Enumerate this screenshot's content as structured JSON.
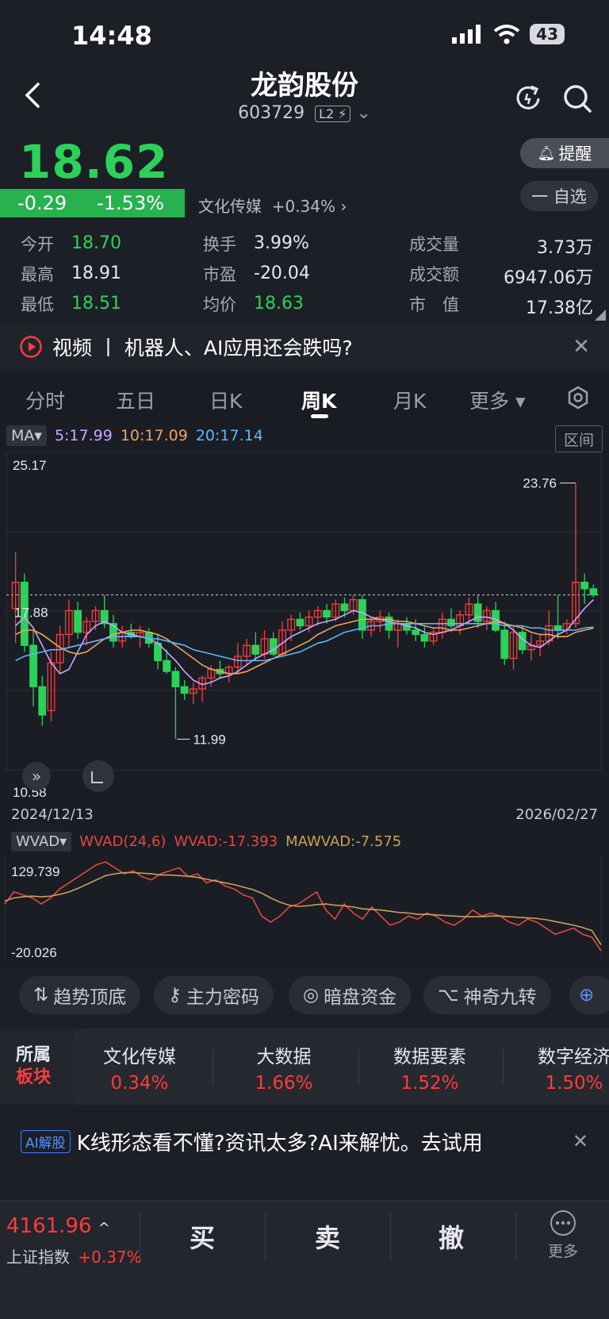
{
  "status_bar": {
    "time": "14:48",
    "battery": "43"
  },
  "header": {
    "title": "龙韵股份",
    "code": "603729",
    "level": "L2"
  },
  "quote": {
    "price": "18.62",
    "change": "-0.29",
    "change_pct": "-1.53%",
    "sector_name": "文化传媒",
    "sector_change": "+0.34%",
    "alert_label": "提醒",
    "watch_label": "一 自选"
  },
  "stats": {
    "open_label": "今开",
    "open": "18.70",
    "high_label": "最高",
    "high": "18.91",
    "low_label": "最低",
    "low": "18.51",
    "turnover_label": "换手",
    "turnover": "3.99%",
    "pe_label": "市盈",
    "pe": "-20.04",
    "avg_label": "均价",
    "avg": "18.63",
    "volume_label": "成交量",
    "volume": "3.73万",
    "amount_label": "成交额",
    "amount": "6947.06万",
    "cap_label": "市　值",
    "cap": "17.38亿"
  },
  "news": {
    "text": "视频  丨  机器人、AI应用还会跌吗?"
  },
  "tabs": [
    "分时",
    "五日",
    "日K",
    "周K",
    "月K",
    "更多"
  ],
  "ma": {
    "label": "MA",
    "ma5": "5:17.99",
    "ma10": "10:17.09",
    "ma20": "20:17.14",
    "range_label": "区间"
  },
  "colors": {
    "up": "#ff3b3b",
    "down": "#2bd25a",
    "ma5": "#c9a6ff",
    "ma10": "#f0a35c",
    "ma20": "#5bb8ff",
    "wvad": "#e6473f",
    "mawvad": "#c9a05a"
  },
  "chart_data": [
    {
      "type": "candlestick",
      "title": "周K",
      "y_top_label": "25.17",
      "y_bottom_label": "10.58",
      "ref_label": "17.88",
      "max_label": "23.76",
      "min_label": "11.99",
      "start_date": "2024/12/13",
      "end_date": "2026/02/27",
      "ylim": [
        10.58,
        25.17
      ],
      "candles": [
        [
          18.0,
          20.6,
          16.4,
          19.2
        ],
        [
          19.2,
          19.6,
          16.0,
          16.3
        ],
        [
          16.3,
          17.0,
          13.5,
          14.4
        ],
        [
          14.4,
          14.9,
          12.6,
          13.1
        ],
        [
          13.3,
          16.0,
          12.8,
          15.5
        ],
        [
          15.5,
          17.2,
          15.0,
          16.8
        ],
        [
          16.8,
          18.4,
          16.2,
          17.9
        ],
        [
          17.9,
          18.3,
          16.6,
          16.9
        ],
        [
          16.9,
          17.6,
          16.3,
          17.4
        ],
        [
          17.4,
          18.1,
          17.0,
          17.9
        ],
        [
          17.9,
          18.6,
          17.1,
          17.3
        ],
        [
          17.3,
          17.7,
          16.2,
          16.5
        ],
        [
          16.5,
          17.2,
          16.2,
          16.9
        ],
        [
          16.9,
          17.3,
          16.6,
          16.7
        ],
        [
          16.7,
          17.2,
          16.2,
          16.9
        ],
        [
          16.9,
          17.1,
          16.2,
          16.4
        ],
        [
          16.4,
          16.8,
          15.2,
          15.6
        ],
        [
          15.6,
          16.1,
          15.0,
          15.1
        ],
        [
          15.1,
          15.3,
          11.99,
          14.4
        ],
        [
          14.4,
          14.7,
          13.8,
          14.1
        ],
        [
          14.1,
          14.6,
          13.6,
          14.3
        ],
        [
          14.3,
          14.9,
          13.7,
          14.8
        ],
        [
          14.8,
          15.4,
          14.4,
          15.2
        ],
        [
          15.2,
          15.6,
          14.8,
          15.0
        ],
        [
          15.0,
          15.4,
          14.6,
          15.3
        ],
        [
          15.3,
          16.4,
          15.0,
          15.8
        ],
        [
          15.8,
          16.6,
          15.4,
          16.3
        ],
        [
          16.3,
          16.9,
          15.6,
          15.9
        ],
        [
          15.9,
          17.0,
          15.7,
          16.6
        ],
        [
          16.6,
          16.9,
          15.8,
          15.9
        ],
        [
          15.9,
          17.4,
          15.8,
          17.0
        ],
        [
          17.0,
          17.7,
          16.5,
          17.5
        ],
        [
          17.5,
          17.8,
          17.0,
          17.2
        ],
        [
          17.2,
          17.9,
          16.9,
          17.6
        ],
        [
          17.6,
          18.1,
          17.2,
          17.9
        ],
        [
          17.9,
          18.2,
          17.3,
          17.6
        ],
        [
          17.6,
          18.4,
          17.4,
          18.2
        ],
        [
          18.2,
          18.5,
          17.6,
          17.9
        ],
        [
          17.9,
          18.6,
          17.7,
          18.4
        ],
        [
          18.4,
          18.6,
          16.6,
          17.0
        ],
        [
          17.0,
          17.6,
          16.7,
          17.4
        ],
        [
          17.4,
          17.9,
          16.9,
          17.6
        ],
        [
          17.6,
          17.8,
          16.6,
          17.0
        ],
        [
          17.0,
          17.5,
          16.2,
          17.3
        ],
        [
          17.3,
          17.6,
          16.8,
          17.0
        ],
        [
          17.0,
          17.5,
          16.5,
          16.8
        ],
        [
          16.8,
          17.2,
          16.2,
          16.5
        ],
        [
          16.5,
          17.1,
          16.3,
          16.9
        ],
        [
          16.9,
          17.8,
          16.6,
          17.5
        ],
        [
          17.5,
          18.0,
          16.9,
          17.2
        ],
        [
          17.2,
          17.9,
          16.8,
          17.7
        ],
        [
          17.7,
          18.5,
          17.3,
          18.2
        ],
        [
          18.2,
          18.6,
          17.1,
          17.4
        ],
        [
          17.4,
          18.1,
          17.0,
          17.9
        ],
        [
          17.9,
          18.3,
          16.9,
          17.0
        ],
        [
          17.0,
          17.4,
          15.4,
          15.7
        ],
        [
          15.7,
          17.2,
          15.2,
          16.9
        ],
        [
          16.9,
          17.2,
          15.9,
          16.1
        ],
        [
          16.1,
          16.8,
          15.6,
          16.3
        ],
        [
          16.3,
          16.8,
          15.8,
          16.5
        ],
        [
          16.5,
          17.9,
          16.3,
          17.2
        ],
        [
          17.2,
          18.6,
          16.6,
          17.0
        ],
        [
          17.0,
          17.5,
          16.8,
          17.3
        ],
        [
          17.3,
          23.76,
          17.1,
          19.2
        ],
        [
          19.2,
          19.6,
          18.2,
          18.9
        ],
        [
          18.9,
          19.1,
          18.5,
          18.62
        ]
      ],
      "ma5": [
        17.2,
        17.6,
        17.1,
        16.3,
        15.5,
        15.0,
        15.2,
        16.0,
        16.8,
        17.2,
        17.4,
        17.2,
        16.9,
        16.8,
        16.7,
        16.6,
        16.4,
        16.0,
        15.6,
        15.1,
        14.7,
        14.5,
        14.6,
        14.8,
        14.9,
        15.1,
        15.4,
        15.7,
        15.9,
        16.1,
        16.4,
        16.7,
        16.9,
        17.1,
        17.3,
        17.4,
        17.5,
        17.7,
        17.9,
        17.8,
        17.6,
        17.5,
        17.4,
        17.3,
        17.2,
        17.1,
        16.9,
        16.8,
        16.9,
        17.0,
        17.2,
        17.4,
        17.6,
        17.6,
        17.5,
        17.3,
        17.0,
        16.6,
        16.3,
        16.2,
        16.5,
        16.8,
        17.0,
        17.5,
        18.0,
        18.4
      ],
      "ma10": [
        16.8,
        17.0,
        17.0,
        16.8,
        16.5,
        16.2,
        16.0,
        15.9,
        16.0,
        16.3,
        16.6,
        16.8,
        16.9,
        17.0,
        17.0,
        16.9,
        16.8,
        16.6,
        16.3,
        16.0,
        15.7,
        15.4,
        15.2,
        15.1,
        15.0,
        15.0,
        15.1,
        15.3,
        15.5,
        15.7,
        15.9,
        16.1,
        16.3,
        16.5,
        16.8,
        17.0,
        17.2,
        17.3,
        17.4,
        17.5,
        17.5,
        17.5,
        17.5,
        17.4,
        17.4,
        17.3,
        17.2,
        17.1,
        17.1,
        17.0,
        17.0,
        17.1,
        17.2,
        17.3,
        17.4,
        17.3,
        17.2,
        17.1,
        16.9,
        16.8,
        16.8,
        16.7,
        16.7,
        16.9,
        17.0,
        17.09
      ],
      "ma20": [
        15.6,
        15.8,
        15.9,
        16.0,
        16.1,
        16.1,
        16.2,
        16.3,
        16.4,
        16.5,
        16.6,
        16.7,
        16.7,
        16.7,
        16.7,
        16.6,
        16.6,
        16.5,
        16.4,
        16.3,
        16.1,
        16.0,
        15.9,
        15.8,
        15.7,
        15.6,
        15.6,
        15.6,
        15.6,
        15.7,
        15.8,
        15.9,
        16.0,
        16.2,
        16.4,
        16.5,
        16.7,
        16.9,
        17.0,
        17.1,
        17.2,
        17.2,
        17.3,
        17.3,
        17.3,
        17.3,
        17.3,
        17.3,
        17.3,
        17.3,
        17.3,
        17.3,
        17.3,
        17.3,
        17.3,
        17.2,
        17.2,
        17.2,
        17.1,
        17.1,
        17.0,
        17.0,
        17.0,
        17.0,
        17.1,
        17.14
      ]
    },
    {
      "type": "line",
      "title": "WVAD(24,6)",
      "indicator_label": "WVAD",
      "params_label": "WVAD(24,6)",
      "wvad_label": "WVAD:-17.393",
      "mawvad_label": "MAWVAD:-7.575",
      "y_top_label": "129.739",
      "y_bottom_label": "-20.026",
      "ylim": [
        -20.026,
        129.739
      ],
      "series": [
        {
          "name": "WVAD",
          "values": [
            60,
            80,
            75,
            70,
            60,
            70,
            85,
            95,
            105,
            115,
            125,
            129.7,
            120,
            110,
            115,
            105,
            100,
            110,
            115,
            120,
            105,
            110,
            95,
            100,
            90,
            85,
            75,
            70,
            40,
            30,
            40,
            55,
            60,
            70,
            80,
            50,
            35,
            60,
            45,
            35,
            55,
            40,
            25,
            30,
            40,
            35,
            45,
            40,
            30,
            25,
            35,
            50,
            40,
            45,
            40,
            30,
            25,
            35,
            30,
            20,
            10,
            15,
            20,
            10,
            5,
            -17.4
          ]
        },
        {
          "name": "MAWVAD",
          "values": [
            65,
            70,
            72,
            73,
            72,
            73,
            76,
            80,
            86,
            93,
            100,
            107,
            110,
            112,
            112,
            111,
            110,
            108,
            108,
            107,
            106,
            104,
            101,
            98,
            95,
            92,
            88,
            84,
            78,
            70,
            63,
            58,
            56,
            57,
            59,
            60,
            58,
            57,
            55,
            52,
            51,
            50,
            48,
            46,
            45,
            43,
            43,
            42,
            41,
            40,
            39,
            39,
            39,
            40,
            40,
            39,
            38,
            37,
            36,
            34,
            31,
            28,
            25,
            21,
            16,
            -7.6
          ]
        }
      ]
    }
  ],
  "tools": [
    "趋势顶底",
    "主力密码",
    "暗盘资金",
    "神奇九转"
  ],
  "sectors_panel": {
    "label_top": "所属",
    "label_bottom": "板块",
    "items": [
      {
        "name": "文化传媒",
        "pct": "0.34%"
      },
      {
        "name": "大数据",
        "pct": "1.66%"
      },
      {
        "name": "数据要素",
        "pct": "1.52%"
      },
      {
        "name": "数字经济",
        "pct": "1.50%"
      }
    ]
  },
  "ai_banner": {
    "badge": "AI解股",
    "text": "K线形态看不懂?资讯太多?AI来解忧。去试用"
  },
  "bottom": {
    "index_value": "4161.96",
    "index_name": "上证指数",
    "index_change": "+0.37%",
    "buy": "买",
    "sell": "卖",
    "cancel": "撤",
    "more": "更多"
  }
}
